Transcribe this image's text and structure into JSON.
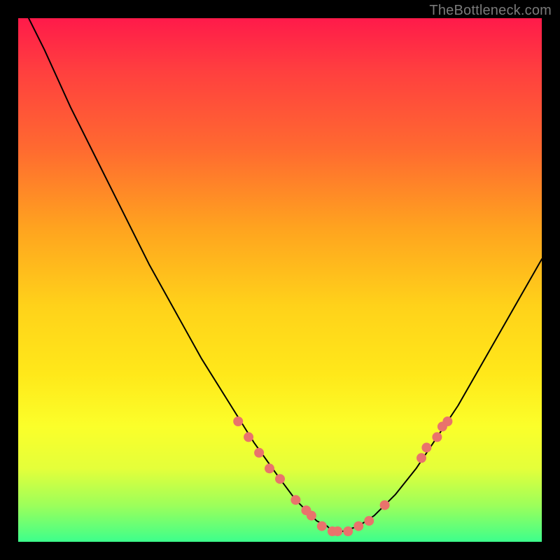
{
  "watermark": "TheBottleneck.com",
  "accent_dot_color": "#e9736c",
  "curve_color": "#000000",
  "chart_data": {
    "type": "line",
    "title": "",
    "xlabel": "",
    "ylabel": "",
    "xlim": [
      0,
      100
    ],
    "ylim": [
      0,
      100
    ],
    "grid": false,
    "legend_position": "none",
    "series": [
      {
        "name": "bottleneck-curve",
        "x": [
          2,
          5,
          10,
          15,
          20,
          25,
          30,
          35,
          40,
          45,
          50,
          53,
          55,
          57,
          59,
          60,
          62,
          65,
          68,
          72,
          76,
          80,
          84,
          88,
          92,
          96,
          100
        ],
        "y": [
          100,
          94,
          83,
          73,
          63,
          53,
          44,
          35,
          27,
          19,
          12,
          8,
          6,
          4,
          3,
          2,
          2,
          3,
          5,
          9,
          14,
          20,
          26,
          33,
          40,
          47,
          54
        ]
      }
    ],
    "annotations": [
      {
        "name": "highlight-dots",
        "comment": "Clustered coral markers near the valley and on the right ascending branch",
        "points": [
          {
            "x": 42,
            "y": 23
          },
          {
            "x": 44,
            "y": 20
          },
          {
            "x": 46,
            "y": 17
          },
          {
            "x": 48,
            "y": 14
          },
          {
            "x": 50,
            "y": 12
          },
          {
            "x": 53,
            "y": 8
          },
          {
            "x": 55,
            "y": 6
          },
          {
            "x": 56,
            "y": 5
          },
          {
            "x": 58,
            "y": 3
          },
          {
            "x": 60,
            "y": 2
          },
          {
            "x": 61,
            "y": 2
          },
          {
            "x": 63,
            "y": 2
          },
          {
            "x": 65,
            "y": 3
          },
          {
            "x": 67,
            "y": 4
          },
          {
            "x": 70,
            "y": 7
          },
          {
            "x": 77,
            "y": 16
          },
          {
            "x": 78,
            "y": 18
          },
          {
            "x": 80,
            "y": 20
          },
          {
            "x": 81,
            "y": 22
          },
          {
            "x": 82,
            "y": 23
          }
        ]
      }
    ]
  }
}
